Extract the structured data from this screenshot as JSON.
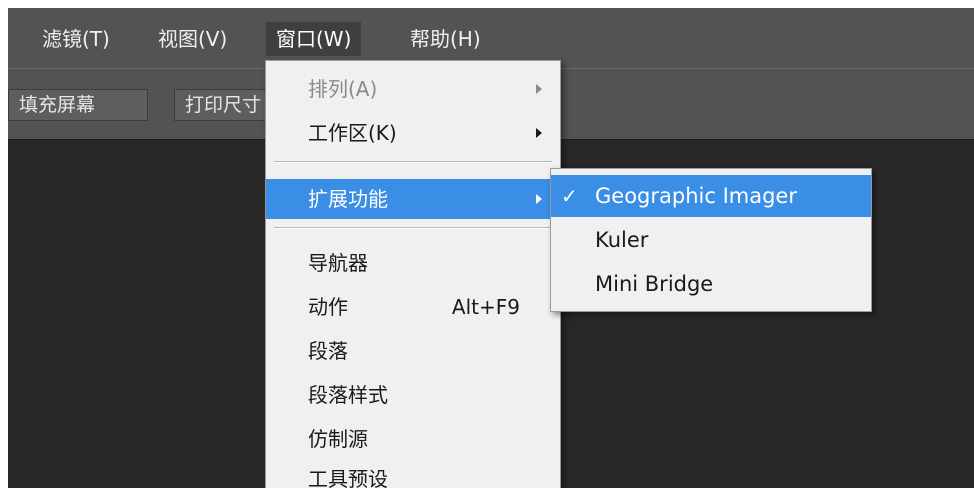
{
  "menubar": {
    "items": [
      {
        "label": "滤镜(T)"
      },
      {
        "label": "视图(V)"
      },
      {
        "label": "窗口(W)"
      },
      {
        "label": "帮助(H)"
      }
    ]
  },
  "optionsbar": {
    "buttons": [
      {
        "label": "填充屏幕"
      },
      {
        "label": "打印尺寸"
      }
    ]
  },
  "window_menu": {
    "items": [
      {
        "label": "排列(A)",
        "disabled": true,
        "submenu": true
      },
      {
        "label": "工作区(K)",
        "submenu": true
      },
      {
        "label": "扩展功能",
        "submenu": true,
        "highlighted": true
      },
      {
        "label": "导航器"
      },
      {
        "label": "动作",
        "shortcut": "Alt+F9"
      },
      {
        "label": "段落"
      },
      {
        "label": "段落样式"
      },
      {
        "label": "仿制源"
      },
      {
        "label": "工具预设"
      }
    ]
  },
  "extensions_submenu": {
    "check_symbol": "✓",
    "items": [
      {
        "label": "Geographic Imager",
        "checked": true,
        "highlighted": true
      },
      {
        "label": "Kuler"
      },
      {
        "label": "Mini Bridge"
      }
    ]
  },
  "colors": {
    "highlight": "#3a8ee6",
    "menubar_bg": "#535353",
    "canvas_bg": "#282828",
    "menu_bg": "#f0f0f0"
  }
}
